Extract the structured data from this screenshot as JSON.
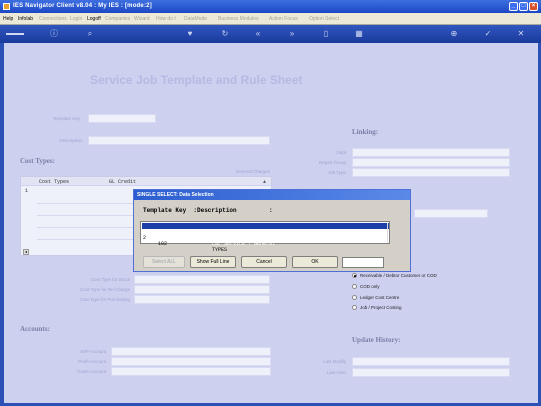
{
  "window": {
    "title": "IES Navigator Client v8.04 : My IES :       [mode:2]",
    "buttons": [
      "minimize",
      "maximize",
      "close"
    ]
  },
  "menubar": {
    "items": [
      {
        "label": "Help",
        "enabled": true
      },
      {
        "label": "Infolab",
        "enabled": true
      },
      {
        "label": "Connections",
        "enabled": false
      },
      {
        "label": "Login",
        "enabled": false
      },
      {
        "label": "Logoff",
        "enabled": true
      },
      {
        "label": "Companies",
        "enabled": false
      },
      {
        "label": "Wizard",
        "enabled": false
      },
      {
        "label": "How do I",
        "enabled": false
      },
      {
        "label": "DataMode",
        "enabled": false
      },
      {
        "label": "Business Modules",
        "enabled": false
      },
      {
        "label": "Action Focus",
        "enabled": false
      },
      {
        "label": "Option Select",
        "enabled": false
      }
    ]
  },
  "toolbar": {
    "icons": [
      "back-icon",
      "info-icon",
      "search-icon",
      "heart-icon",
      "refresh-icon",
      "rewind-icon",
      "forward-icon",
      "document-icon",
      "grid-icon",
      "add-icon",
      "check-icon",
      "close-icon"
    ]
  },
  "form": {
    "title": "Service Job Template and Rule Sheet",
    "template_key_label": "Template Key",
    "description_label": "Description",
    "cost_types_label": "Cost Types:",
    "general_charges_label": "General Charges",
    "cost_grid": {
      "col1": "Cost Types",
      "col2": "GL Credit",
      "row1": "1"
    },
    "cost_type_for_stock_label": "Cost Type for Stock",
    "cost_type_for_re_charge_label": "Cost Type for Re-Charge",
    "cost_type_for_purchasing_label": "Cost Type for Purchasing",
    "linking_label": "Linking:",
    "dept_label": "Dept",
    "repair_group_label": "Repair Group",
    "job_type_label": "Job Type",
    "payment_options": [
      {
        "label": "Receivable / Debtor Customer or COD",
        "selected": true
      },
      {
        "label": "COD only",
        "selected": false
      },
      {
        "label": "Ledger Cost Centre",
        "selected": false
      },
      {
        "label": "Job / Project Costing",
        "selected": false
      }
    ],
    "accounts_label": "Accounts:",
    "wip_account_label": "WIP Account",
    "profit_account_label": "Profit Account",
    "costs_account_label": "Costs Account",
    "update_history_label": "Update History:",
    "last_modify_label": "Last Modify",
    "last_user_label": "Last User"
  },
  "dialog": {
    "title": "SINGLE SELECT: Data Selection",
    "header": "Template Key  :Description         :",
    "rows": [
      {
        "num": "1",
        "key": "101",
        "description": "Car Service - General",
        "selected": true
      },
      {
        "num": "2",
        "key": "102",
        "description": "TYPES",
        "selected": false
      }
    ],
    "buttons": {
      "select_all": "Select ALL",
      "show_full_line": "Show Full Line",
      "cancel": "Cancel",
      "ok": "OK"
    }
  }
}
